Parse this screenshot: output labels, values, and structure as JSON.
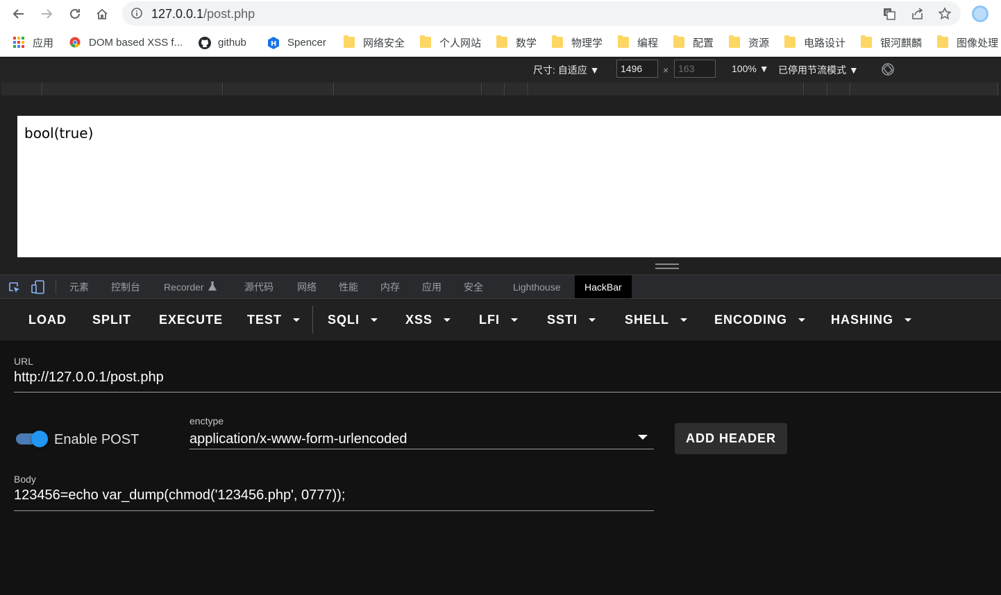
{
  "browser": {
    "url_host": "127.0.0.1",
    "url_path": "/post.php",
    "bookmarks": [
      {
        "label": "应用",
        "icon": "apps-grid-icon"
      },
      {
        "label": "DOM based XSS f...",
        "icon": "chrome-icon"
      },
      {
        "label": "github",
        "icon": "github-icon"
      },
      {
        "label": "Spencer",
        "icon": "hexagon-h-icon"
      },
      {
        "label": "网络安全",
        "icon": "folder-icon"
      },
      {
        "label": "个人网站",
        "icon": "folder-icon"
      },
      {
        "label": "数学",
        "icon": "folder-icon"
      },
      {
        "label": "物理学",
        "icon": "folder-icon"
      },
      {
        "label": "编程",
        "icon": "folder-icon"
      },
      {
        "label": "配置",
        "icon": "folder-icon"
      },
      {
        "label": "资源",
        "icon": "folder-icon"
      },
      {
        "label": "电路设计",
        "icon": "folder-icon"
      },
      {
        "label": "银河麒麟",
        "icon": "folder-icon"
      },
      {
        "label": "图像处理",
        "icon": "folder-icon"
      }
    ]
  },
  "device_toolbar": {
    "size_label": "尺寸: 自适应 ▼",
    "width": "1496",
    "times": "×",
    "height_placeholder": "163",
    "zoom": "100% ▼",
    "throttle": "已停用节流模式 ▼"
  },
  "page": {
    "output": "bool(true)"
  },
  "devtools": {
    "tabs": [
      "元素",
      "控制台",
      "Recorder",
      "源代码",
      "网络",
      "性能",
      "内存",
      "应用",
      "安全",
      "Lighthouse",
      "HackBar"
    ],
    "active_tab": "HackBar"
  },
  "hackbar": {
    "buttons": {
      "load": "LOAD",
      "split": "SPLIT",
      "execute": "EXECUTE",
      "test": "TEST",
      "sqli": "SQLI",
      "xss": "XSS",
      "lfi": "LFI",
      "ssti": "SSTI",
      "shell": "SHELL",
      "encoding": "ENCODING",
      "hashing": "HASHING"
    },
    "url_label": "URL",
    "url_value": "http://127.0.0.1/post.php",
    "enable_post_label": "Enable POST",
    "enable_post": true,
    "enctype_label": "enctype",
    "enctype_value": "application/x-www-form-urlencoded",
    "add_header": "ADD HEADER",
    "body_label": "Body",
    "body_value": "123456=echo var_dump(chmod('123456.php', 0777));"
  }
}
